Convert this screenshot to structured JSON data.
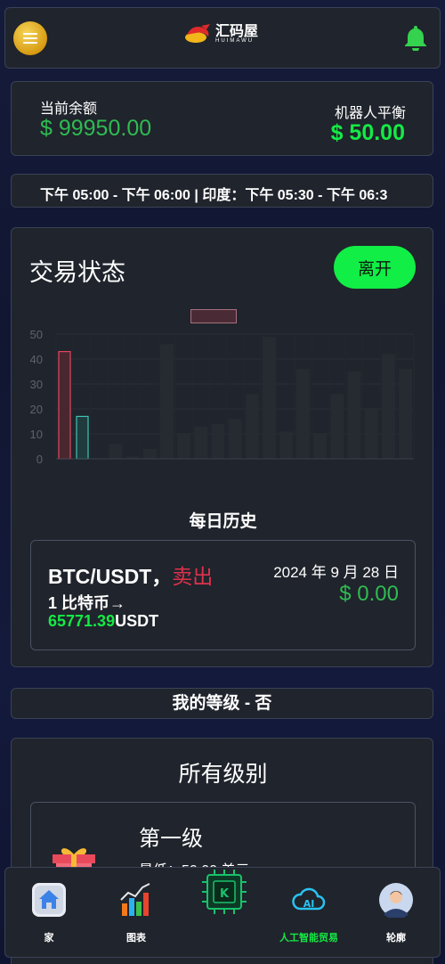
{
  "header": {
    "logo_cn": "汇码屋",
    "logo_en": "HUIMAWU"
  },
  "balance": {
    "current_label": "当前余额",
    "current_value": "$ 99950.00",
    "robot_label": "机器人平衡",
    "robot_value": "$ 50.00"
  },
  "ticker": {
    "text": "下午 05:00 - 下午 06:00 | 印度：下午 05:30 - 下午 06:3"
  },
  "status": {
    "title": "交易状态",
    "leave_label": "离开",
    "history_title": "每日历史"
  },
  "chart_data": {
    "type": "bar",
    "ylim": [
      0,
      50
    ],
    "yticks": [
      "0",
      "10",
      "20",
      "30",
      "40",
      "50"
    ],
    "series": [
      {
        "values": [
          43,
          0,
          0,
          0,
          0,
          0,
          0,
          0,
          0,
          0,
          0,
          0,
          0,
          0,
          0,
          0,
          0,
          0,
          0,
          0,
          0,
          0,
          0,
          0,
          0,
          0,
          0,
          0
        ]
      },
      {
        "values": [
          0,
          0,
          17,
          0,
          0,
          0,
          0,
          0,
          0,
          0,
          0,
          0,
          0,
          0,
          0,
          0,
          0,
          0,
          0,
          0,
          0,
          0,
          0,
          0,
          0,
          0,
          0,
          0
        ]
      }
    ],
    "background_values": [
      0,
      0,
      0,
      6,
      1,
      4,
      46,
      10,
      13,
      14,
      16,
      26,
      49,
      11,
      36,
      10,
      26,
      35,
      20,
      42,
      36
    ],
    "colors": {
      "series1": "#e0475d",
      "series2": "#3ec3b6"
    }
  },
  "trade": {
    "pair": "BTC/USDT，",
    "side": "卖出",
    "qty": "1 比特币→",
    "price_num": "65771.39",
    "price_unit": "USDT",
    "date": "2024 年 9 月 28 日",
    "amount": "$ 0.00"
  },
  "mylevel": {
    "text": "我的等级 - 否"
  },
  "levels": {
    "title": "所有级别",
    "items": [
      {
        "name": "第一级",
        "min": "最低：50.00 美元"
      }
    ]
  },
  "nav": {
    "items": [
      {
        "label": "家"
      },
      {
        "label": "图表"
      },
      {
        "label": "人工智能贸易"
      },
      {
        "label": "轮廓"
      }
    ]
  },
  "colors": {
    "accent_green": "#14ea45",
    "value_green": "#2fbb52",
    "sell_red": "#e0314b",
    "card_bg": "#20242c"
  }
}
